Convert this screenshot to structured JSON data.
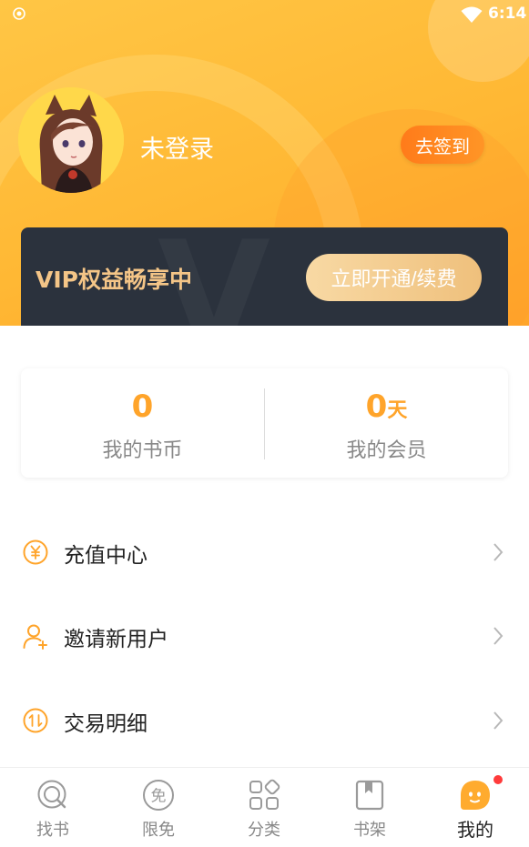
{
  "status_bar": {
    "time": "6:14"
  },
  "profile": {
    "name": "未登录",
    "checkin_label": "去签到"
  },
  "vip": {
    "title": "VIP权益畅享中",
    "button_label": "立即开通/续费"
  },
  "stats": {
    "coins": {
      "value": "0",
      "label": "我的书币"
    },
    "membership": {
      "value": "0",
      "unit": "天",
      "label": "我的会员"
    }
  },
  "menu": {
    "items": [
      {
        "label": "充值中心",
        "icon": "yuan-icon"
      },
      {
        "label": "邀请新用户",
        "icon": "add-user-icon"
      },
      {
        "label": "交易明细",
        "icon": "transaction-icon"
      }
    ]
  },
  "tabbar": {
    "items": [
      {
        "label": "找书",
        "icon": "search-book-icon"
      },
      {
        "label": "限免",
        "icon": "free-icon",
        "icon_text": "免"
      },
      {
        "label": "分类",
        "icon": "category-icon"
      },
      {
        "label": "书架",
        "icon": "bookshelf-icon"
      },
      {
        "label": "我的",
        "icon": "me-icon",
        "active": true
      }
    ]
  },
  "colors": {
    "accent": "#ffa42a",
    "vip_gold": "#f4c587",
    "vip_dark": "#2b323d",
    "checkin": "#ff8a1f"
  }
}
